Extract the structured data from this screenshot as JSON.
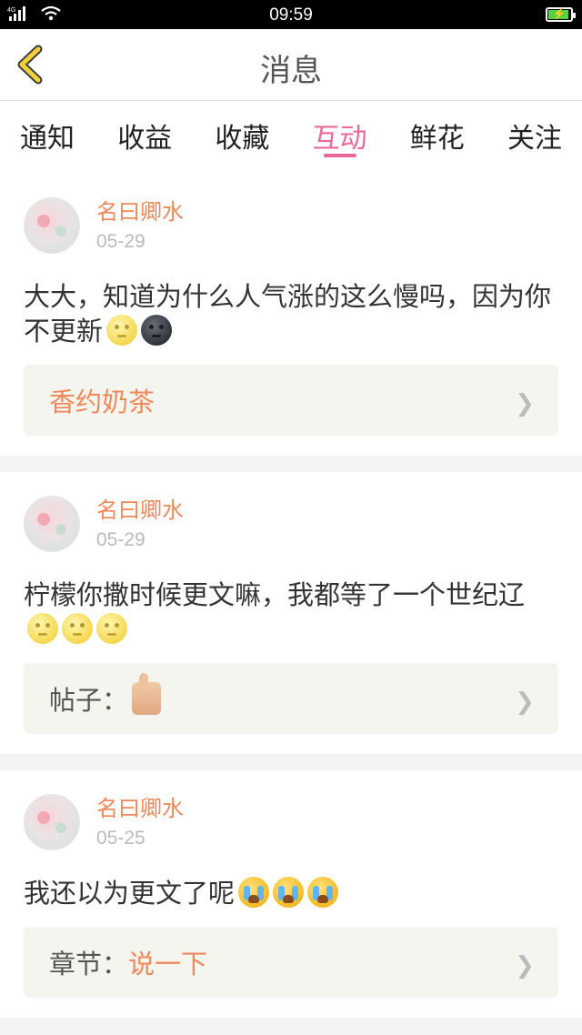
{
  "status_bar": {
    "network": "4G",
    "time": "09:59"
  },
  "header": {
    "title": "消息"
  },
  "tabs": [
    {
      "label": "通知"
    },
    {
      "label": "收益"
    },
    {
      "label": "收藏"
    },
    {
      "label": "互动"
    },
    {
      "label": "鲜花"
    },
    {
      "label": "关注"
    }
  ],
  "active_tab": "互动",
  "messages": [
    {
      "user": "名曰卿水",
      "date": "05-29",
      "text": "大大，知道为什么人气涨的这么慢吗，因为你不更新",
      "emojis": [
        "full-moon-face",
        "new-moon-face"
      ],
      "link_prefix": "",
      "link_value": "香约奶茶"
    },
    {
      "user": "名曰卿水",
      "date": "05-29",
      "text": "柠檬你撒时候更文嘛，我都等了一个世纪辽",
      "emojis": [
        "full-moon-face",
        "full-moon-face",
        "full-moon-face"
      ],
      "link_prefix": "帖子：",
      "link_value": ""
    },
    {
      "user": "名曰卿水",
      "date": "05-25",
      "text": "我还以为更文了呢",
      "emojis": [
        "crying-face",
        "crying-face",
        "crying-face"
      ],
      "link_prefix": "章节：",
      "link_value": "说一下"
    }
  ],
  "colors": {
    "accent_pink": "#e8689a",
    "accent_orange": "#f0895a",
    "back_yellow": "#f2cf3c"
  }
}
